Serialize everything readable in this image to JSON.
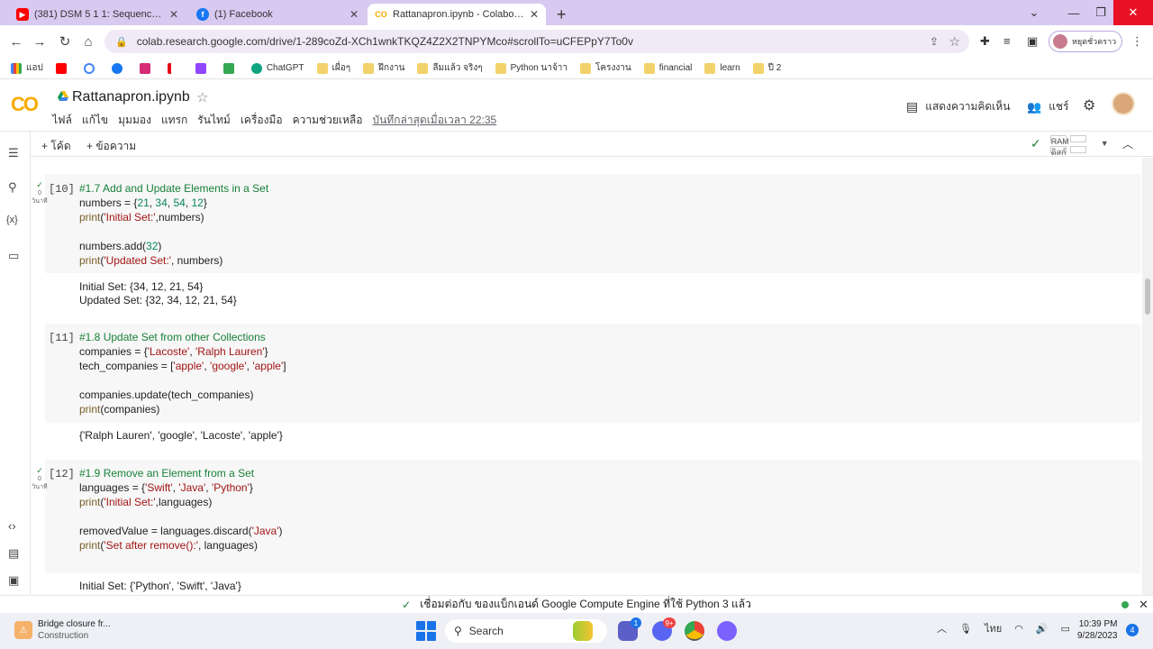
{
  "browser": {
    "tabs": [
      {
        "title": "(381) DSM 5 1 1: Sequences - Yo",
        "icon": "youtube-icon"
      },
      {
        "title": "(1) Facebook",
        "icon": "facebook-icon"
      },
      {
        "title": "Rattanapron.ipynb - Colaborato",
        "icon": "colab-icon"
      }
    ],
    "new_tab": "+",
    "url": "colab.research.google.com/drive/1-289coZd-XCh1wnkTKQZ4Z2X2TNPYMco#scrollTo=uCFEPpY7To0v",
    "profile_label": "หยุดชั่วคราว",
    "bookmarks": [
      {
        "label": "แอป",
        "icon": "apps-grid-icon"
      },
      {
        "label": "ChatGPT",
        "icon": "chatgpt-icon"
      },
      {
        "label": "เผื่อๆ",
        "icon": "folder-icon"
      },
      {
        "label": "ฝึกงาน",
        "icon": "folder-icon"
      },
      {
        "label": "ลืมแล้ว จริงๆ",
        "icon": "folder-icon"
      },
      {
        "label": "Python นาจ้าา",
        "icon": "folder-icon"
      },
      {
        "label": "โครงงาน",
        "icon": "folder-icon"
      },
      {
        "label": "financial",
        "icon": "folder-icon"
      },
      {
        "label": "learn",
        "icon": "folder-icon"
      },
      {
        "label": "ปี 2",
        "icon": "folder-icon"
      }
    ]
  },
  "colab": {
    "logo": "CO",
    "notebook_title": "Rattanapron.ipynb",
    "menu": [
      "ไฟล์",
      "แก้ไข",
      "มุมมอง",
      "แทรก",
      "รันไทม์",
      "เครื่องมือ",
      "ความช่วยเหลือ"
    ],
    "last_saved": "บันทึกล่าสุดเมื่อเวลา 22:35",
    "comment_label": "แสดงความคิดเห็น",
    "share_label": "แชร์",
    "add_code": "+ โค้ด",
    "add_text": "+ ข้อความ",
    "ram_label": "RAM",
    "disk_label": "ดิสก์"
  },
  "cells": [
    {
      "count": "[10]",
      "run_time": "0",
      "run_unit": "วินาที",
      "lines": [
        [
          {
            "t": "#1.7 Add and Update Elements in a Set",
            "c": "cm"
          }
        ],
        [
          {
            "t": "numbers = "
          },
          {
            "t": "{",
            "c": ""
          },
          {
            "t": "21",
            "c": "nm"
          },
          {
            "t": ", "
          },
          {
            "t": "34",
            "c": "nm"
          },
          {
            "t": ", "
          },
          {
            "t": "54",
            "c": "nm"
          },
          {
            "t": ", "
          },
          {
            "t": "12",
            "c": "nm"
          },
          {
            "t": "}"
          }
        ],
        [
          {
            "t": "print",
            "c": "fn"
          },
          {
            "t": "("
          },
          {
            "t": "'Initial Set:'",
            "c": "st"
          },
          {
            "t": ",numbers)"
          }
        ],
        [
          {
            "t": ""
          }
        ],
        [
          {
            "t": "numbers.add("
          },
          {
            "t": "32",
            "c": "nm"
          },
          {
            "t": ")"
          }
        ],
        [
          {
            "t": "print",
            "c": "fn"
          },
          {
            "t": "("
          },
          {
            "t": "'Updated Set:'",
            "c": "st"
          },
          {
            "t": ", numbers)"
          }
        ]
      ],
      "output": [
        "Initial Set: {34, 12, 21, 54}",
        "Updated Set: {32, 34, 12, 21, 54}"
      ]
    },
    {
      "count": "[11]",
      "run_time": "",
      "run_unit": "",
      "lines": [
        [
          {
            "t": "#1.8 Update Set from other Collections",
            "c": "cm"
          }
        ],
        [
          {
            "t": "companies = {"
          },
          {
            "t": "'Lacoste'",
            "c": "st"
          },
          {
            "t": ", "
          },
          {
            "t": "'Ralph Lauren'",
            "c": "st"
          },
          {
            "t": "}"
          }
        ],
        [
          {
            "t": "tech_companies = ["
          },
          {
            "t": "'apple'",
            "c": "st"
          },
          {
            "t": ", "
          },
          {
            "t": "'google'",
            "c": "st"
          },
          {
            "t": ", "
          },
          {
            "t": "'apple'",
            "c": "st"
          },
          {
            "t": "]"
          }
        ],
        [
          {
            "t": ""
          }
        ],
        [
          {
            "t": "companies.update(tech_companies)"
          }
        ],
        [
          {
            "t": "print",
            "c": "fn"
          },
          {
            "t": "(companies)"
          }
        ]
      ],
      "output": [
        "{'Ralph Lauren', 'google', 'Lacoste', 'apple'}"
      ]
    },
    {
      "count": "[12]",
      "run_time": "0",
      "run_unit": "วินาที",
      "lines": [
        [
          {
            "t": "#1.9 Remove an Element from a Set",
            "c": "cm"
          }
        ],
        [
          {
            "t": "languages = {"
          },
          {
            "t": "'Swift'",
            "c": "st"
          },
          {
            "t": ", "
          },
          {
            "t": "'Java'",
            "c": "st"
          },
          {
            "t": ", "
          },
          {
            "t": "'Python'",
            "c": "st"
          },
          {
            "t": "}"
          }
        ],
        [
          {
            "t": "print",
            "c": "fn"
          },
          {
            "t": "("
          },
          {
            "t": "'Initial Set:'",
            "c": "st"
          },
          {
            "t": ",languages)"
          }
        ],
        [
          {
            "t": ""
          }
        ],
        [
          {
            "t": "removedValue = languages.discard("
          },
          {
            "t": "'Java'",
            "c": "st"
          },
          {
            "t": ")"
          }
        ],
        [
          {
            "t": "print",
            "c": "fn"
          },
          {
            "t": "("
          },
          {
            "t": "'Set after remove():'",
            "c": "st"
          },
          {
            "t": ", languages)"
          }
        ]
      ],
      "output": [
        "Initial Set: {'Python', 'Swift', 'Java'}"
      ]
    }
  ],
  "status": {
    "message": "เชื่อมต่อกับ ของแบ็กเอนด์ Google Compute Engine ที่ใช้ Python 3 แล้ว"
  },
  "taskbar": {
    "weather_title": "Bridge closure fr...",
    "weather_sub": "Construction",
    "search_label": "Search",
    "meet_badge": "1",
    "discord_badge": "9+",
    "lang": "ไทย",
    "time": "10:39 PM",
    "date": "9/28/2023",
    "notif_count": "4"
  }
}
